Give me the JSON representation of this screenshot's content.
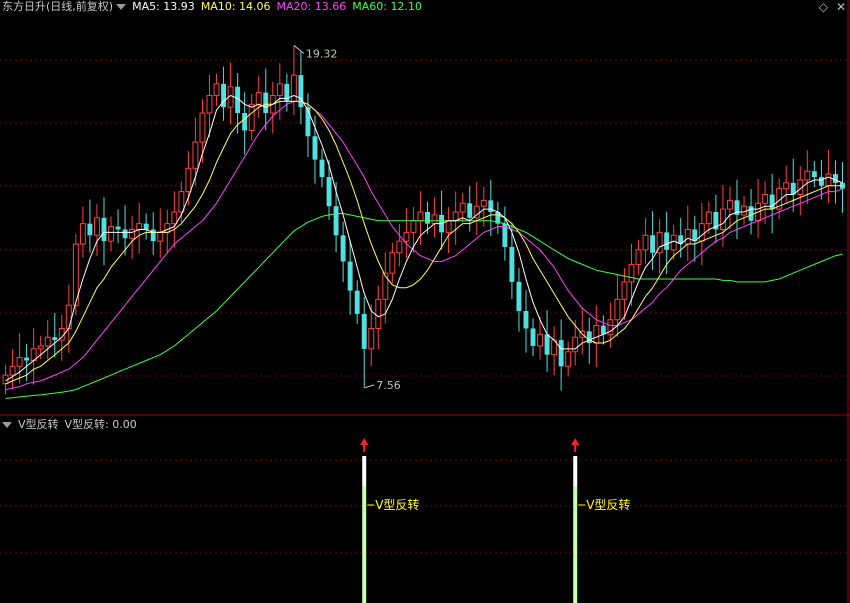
{
  "header": {
    "stock_title": "东方日升(日线,前复权)",
    "ma5_text": "MA5: 13.93",
    "ma10_text": "MA10: 14.06",
    "ma20_text": "MA20: 13.66",
    "ma60_text": "MA60: 12.10"
  },
  "indicator_header": {
    "name": "V型反转",
    "value_text": "V型反转: 0.00"
  },
  "nav": {
    "diamond": "◇",
    "close": "✕"
  },
  "colors": {
    "background": "#000000",
    "grid": "#7a0000",
    "separator": "#b00000",
    "up_candle": "#ff4040",
    "down_candle": "#50e0e0",
    "ma5": "#ffffff",
    "ma10": "#ffff55",
    "ma20": "#ff40ff",
    "ma60": "#40ff40",
    "signal_arrow": "#ff2020",
    "signal_bar": "#c8ffb0",
    "signal_label": "#ffff00"
  },
  "chart_data": {
    "type": "candlestick",
    "x_count": 120,
    "ylim": [
      6.8,
      20.4
    ],
    "price_labels": {
      "high": "19.32",
      "low": "7.56"
    },
    "high_point": {
      "index": 41,
      "value": 19.32
    },
    "low_point": {
      "index": 51,
      "value": 7.56
    },
    "closes": [
      8.0,
      8.3,
      8.6,
      8.5,
      8.9,
      9.0,
      9.3,
      9.2,
      9.6,
      10.4,
      12.5,
      13.2,
      12.8,
      13.4,
      12.6,
      13.1,
      13.0,
      12.7,
      13.0,
      13.2,
      13.0,
      12.6,
      12.9,
      13.2,
      13.6,
      14.3,
      15.1,
      16.0,
      17.0,
      17.6,
      18.0,
      17.2,
      17.9,
      17.0,
      16.4,
      17.3,
      17.7,
      17.0,
      17.6,
      18.0,
      17.4,
      18.3,
      17.2,
      16.2,
      15.4,
      14.8,
      13.8,
      12.8,
      11.9,
      10.9,
      10.1,
      8.9,
      9.6,
      10.6,
      11.5,
      12.2,
      12.6,
      12.9,
      13.3,
      13.6,
      13.2,
      13.5,
      12.9,
      13.3,
      13.6,
      13.9,
      13.4,
      13.8,
      14.0,
      13.6,
      13.2,
      12.4,
      11.2,
      10.2,
      9.6,
      9.0,
      9.4,
      8.7,
      9.2,
      8.3,
      8.8,
      9.3,
      9.5,
      9.1,
      9.7,
      9.4,
      9.9,
      10.6,
      11.2,
      11.8,
      12.3,
      12.8,
      12.2,
      12.9,
      12.3,
      12.8,
      12.5,
      13.0,
      12.6,
      13.2,
      13.6,
      13.0,
      13.7,
      14.0,
      13.5,
      13.8,
      13.3,
      13.9,
      14.2,
      13.7,
      14.4,
      14.6,
      14.2,
      14.7,
      15.0,
      14.8,
      14.5,
      14.9,
      14.6,
      14.4
    ],
    "ma5": [
      7.8,
      7.95,
      8.1,
      8.3,
      8.5,
      8.7,
      8.9,
      9.1,
      9.3,
      9.6,
      10.5,
      11.3,
      12.0,
      12.6,
      12.9,
      12.9,
      12.9,
      12.9,
      12.9,
      13.0,
      13.0,
      12.9,
      12.9,
      13.0,
      13.1,
      13.5,
      14.1,
      14.8,
      15.6,
      16.3,
      17.1,
      17.4,
      17.6,
      17.5,
      17.3,
      17.2,
      17.3,
      17.2,
      17.3,
      17.5,
      17.5,
      17.6,
      17.5,
      17.1,
      16.5,
      15.9,
      15.2,
      14.3,
      13.5,
      12.6,
      11.7,
      10.8,
      10.2,
      10.0,
      10.1,
      10.6,
      11.3,
      11.9,
      12.4,
      12.8,
      13.0,
      13.2,
      13.2,
      13.3,
      13.3,
      13.4,
      13.3,
      13.5,
      13.7,
      13.7,
      13.6,
      13.4,
      12.9,
      12.2,
      11.3,
      10.5,
      9.9,
      9.4,
      9.2,
      8.9,
      8.9,
      8.9,
      9.1,
      9.2,
      9.3,
      9.4,
      9.5,
      9.7,
      10.0,
      10.6,
      11.2,
      11.7,
      12.0,
      12.4,
      12.5,
      12.6,
      12.5,
      12.7,
      12.6,
      12.8,
      13.0,
      13.1,
      13.2,
      13.5,
      13.6,
      13.6,
      13.7,
      13.7,
      13.8,
      13.8,
      14.0,
      14.2,
      14.2,
      14.4,
      14.6,
      14.7,
      14.7,
      14.8,
      14.7,
      14.6
    ],
    "ma10": [
      7.7,
      7.8,
      7.9,
      8.0,
      8.2,
      8.3,
      8.5,
      8.7,
      8.9,
      9.1,
      9.5,
      10.0,
      10.5,
      11.0,
      11.3,
      11.7,
      12.0,
      12.3,
      12.6,
      12.8,
      12.9,
      12.9,
      12.9,
      12.9,
      13.0,
      13.2,
      13.5,
      13.8,
      14.2,
      14.7,
      15.3,
      15.8,
      16.3,
      16.6,
      16.8,
      17.0,
      17.2,
      17.3,
      17.3,
      17.4,
      17.4,
      17.4,
      17.4,
      17.3,
      17.1,
      16.8,
      16.4,
      15.9,
      15.3,
      14.7,
      14.0,
      13.2,
      12.5,
      11.9,
      11.4,
      11.1,
      11.0,
      11.0,
      11.1,
      11.3,
      11.6,
      12.0,
      12.4,
      12.8,
      13.0,
      13.2,
      13.2,
      13.3,
      13.4,
      13.5,
      13.5,
      13.4,
      13.2,
      12.9,
      12.5,
      12.0,
      11.6,
      11.2,
      10.8,
      10.4,
      10.0,
      9.7,
      9.4,
      9.2,
      9.1,
      9.1,
      9.2,
      9.4,
      9.6,
      9.9,
      10.3,
      10.7,
      11.0,
      11.4,
      11.8,
      12.1,
      12.3,
      12.5,
      12.5,
      12.6,
      12.7,
      12.8,
      12.9,
      13.1,
      13.3,
      13.4,
      13.5,
      13.6,
      13.7,
      13.7,
      13.8,
      13.9,
      14.0,
      14.1,
      14.2,
      14.3,
      14.4,
      14.5,
      14.5,
      14.5
    ],
    "ma20": [
      7.5,
      7.55,
      7.6,
      7.7,
      7.75,
      7.8,
      7.9,
      8.0,
      8.1,
      8.2,
      8.4,
      8.6,
      8.9,
      9.2,
      9.5,
      9.8,
      10.1,
      10.4,
      10.7,
      11.0,
      11.3,
      11.6,
      11.9,
      12.2,
      12.5,
      12.7,
      12.9,
      13.1,
      13.3,
      13.6,
      13.9,
      14.3,
      14.7,
      15.1,
      15.5,
      15.9,
      16.3,
      16.6,
      16.9,
      17.1,
      17.3,
      17.4,
      17.4,
      17.3,
      17.1,
      16.9,
      16.6,
      16.3,
      16.0,
      15.6,
      15.2,
      14.8,
      14.3,
      13.9,
      13.5,
      13.1,
      12.8,
      12.5,
      12.3,
      12.1,
      12.0,
      11.9,
      11.9,
      12.0,
      12.1,
      12.3,
      12.5,
      12.7,
      12.9,
      13.0,
      13.1,
      13.1,
      13.0,
      12.9,
      12.7,
      12.5,
      12.3,
      12.0,
      11.7,
      11.3,
      10.9,
      10.6,
      10.3,
      10.1,
      9.9,
      9.8,
      9.7,
      9.7,
      9.8,
      9.9,
      10.1,
      10.3,
      10.5,
      10.8,
      11.0,
      11.3,
      11.6,
      11.8,
      12.0,
      12.2,
      12.4,
      12.6,
      12.7,
      12.9,
      13.0,
      13.1,
      13.2,
      13.3,
      13.4,
      13.5,
      13.6,
      13.7,
      13.8,
      13.9,
      14.0,
      14.1,
      14.2,
      14.3,
      14.3,
      14.4
    ],
    "ma60": [
      7.2,
      7.22,
      7.25,
      7.27,
      7.3,
      7.32,
      7.35,
      7.38,
      7.41,
      7.45,
      7.5,
      7.6,
      7.7,
      7.8,
      7.9,
      8.0,
      8.1,
      8.2,
      8.3,
      8.4,
      8.5,
      8.6,
      8.7,
      8.85,
      9.0,
      9.2,
      9.4,
      9.6,
      9.8,
      10.0,
      10.2,
      10.45,
      10.7,
      10.95,
      11.2,
      11.45,
      11.7,
      11.95,
      12.2,
      12.45,
      12.7,
      12.95,
      13.1,
      13.25,
      13.35,
      13.45,
      13.5,
      13.55,
      13.55,
      13.5,
      13.45,
      13.4,
      13.35,
      13.3,
      13.3,
      13.3,
      13.3,
      13.3,
      13.3,
      13.3,
      13.3,
      13.3,
      13.3,
      13.3,
      13.3,
      13.3,
      13.3,
      13.3,
      13.3,
      13.3,
      13.25,
      13.2,
      13.1,
      13.0,
      12.9,
      12.75,
      12.6,
      12.45,
      12.3,
      12.15,
      12.0,
      11.9,
      11.8,
      11.7,
      11.6,
      11.55,
      11.5,
      11.45,
      11.4,
      11.35,
      11.3,
      11.3,
      11.3,
      11.3,
      11.3,
      11.3,
      11.3,
      11.3,
      11.3,
      11.3,
      11.3,
      11.3,
      11.25,
      11.25,
      11.2,
      11.2,
      11.2,
      11.2,
      11.2,
      11.25,
      11.3,
      11.4,
      11.5,
      11.6,
      11.7,
      11.8,
      11.9,
      12.0,
      12.1,
      12.15
    ],
    "signal": {
      "label": "V型反转",
      "indices": [
        51,
        81
      ]
    }
  }
}
